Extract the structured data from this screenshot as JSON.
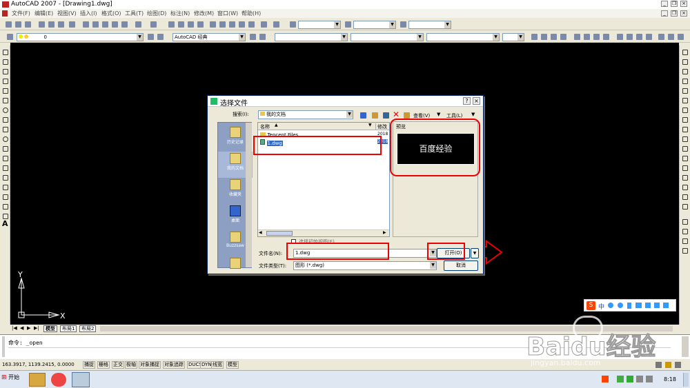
{
  "window": {
    "title": "AutoCAD 2007 - [Drawing1.dwg]"
  },
  "menubar": {
    "items": [
      "文件(F)",
      "编辑(E)",
      "视图(V)",
      "插入(I)",
      "格式(O)",
      "工具(T)",
      "绘图(D)",
      "标注(N)",
      "修改(M)",
      "窗口(W)",
      "帮助(H)"
    ]
  },
  "toolbar2": {
    "layer_value": "0",
    "workspace_value": "AutoCAD 经典"
  },
  "dialog": {
    "title": "选择文件",
    "help": "?",
    "lookin_label": "搜索(I):",
    "lookin_value": "我的文档",
    "view_label": "查看(V)",
    "tools_label": "工具(L)",
    "col_name": "名称",
    "col_date": "修改",
    "files": [
      {
        "name": "Tencent Files",
        "date": "2018"
      },
      {
        "name": "1.dwg",
        "date": "2018"
      }
    ],
    "places": [
      "历史记录",
      "我的文档",
      "收藏夹",
      "桌面",
      "Buzzsaw",
      ""
    ],
    "preview_label": "预览",
    "preview_text": "百度经验",
    "initial_view_label": "选择初始视图(E)",
    "filename_label": "文件名(N):",
    "filename_value": "1.dwg",
    "filetype_label": "文件类型(T):",
    "filetype_value": "图形 (*.dwg)",
    "open_label": "打开(O)",
    "cancel_label": "取消"
  },
  "canvas": {
    "y_axis": "Y",
    "x_axis": "X"
  },
  "tabs": [
    "模型",
    "布局1",
    "布局2"
  ],
  "command": {
    "line": "命令: _open"
  },
  "status": {
    "coords": "163.3917, 1139.2415, 0.0000",
    "toggles": [
      "捕捉",
      "栅格",
      "正交",
      "极轴",
      "对象捕捉",
      "对象追踪",
      "DUCS",
      "DYN",
      "线宽",
      "模型"
    ]
  },
  "taskbar": {
    "start_label": "开始",
    "clock": "8:18"
  },
  "ime": {
    "mode": "中"
  },
  "watermark": {
    "brand": "Baidu经验",
    "url": "jingyan.baidu.com"
  },
  "colors": {
    "canvas": "#000000",
    "highlight": "#e00000",
    "chrome": "#ece9d8"
  }
}
